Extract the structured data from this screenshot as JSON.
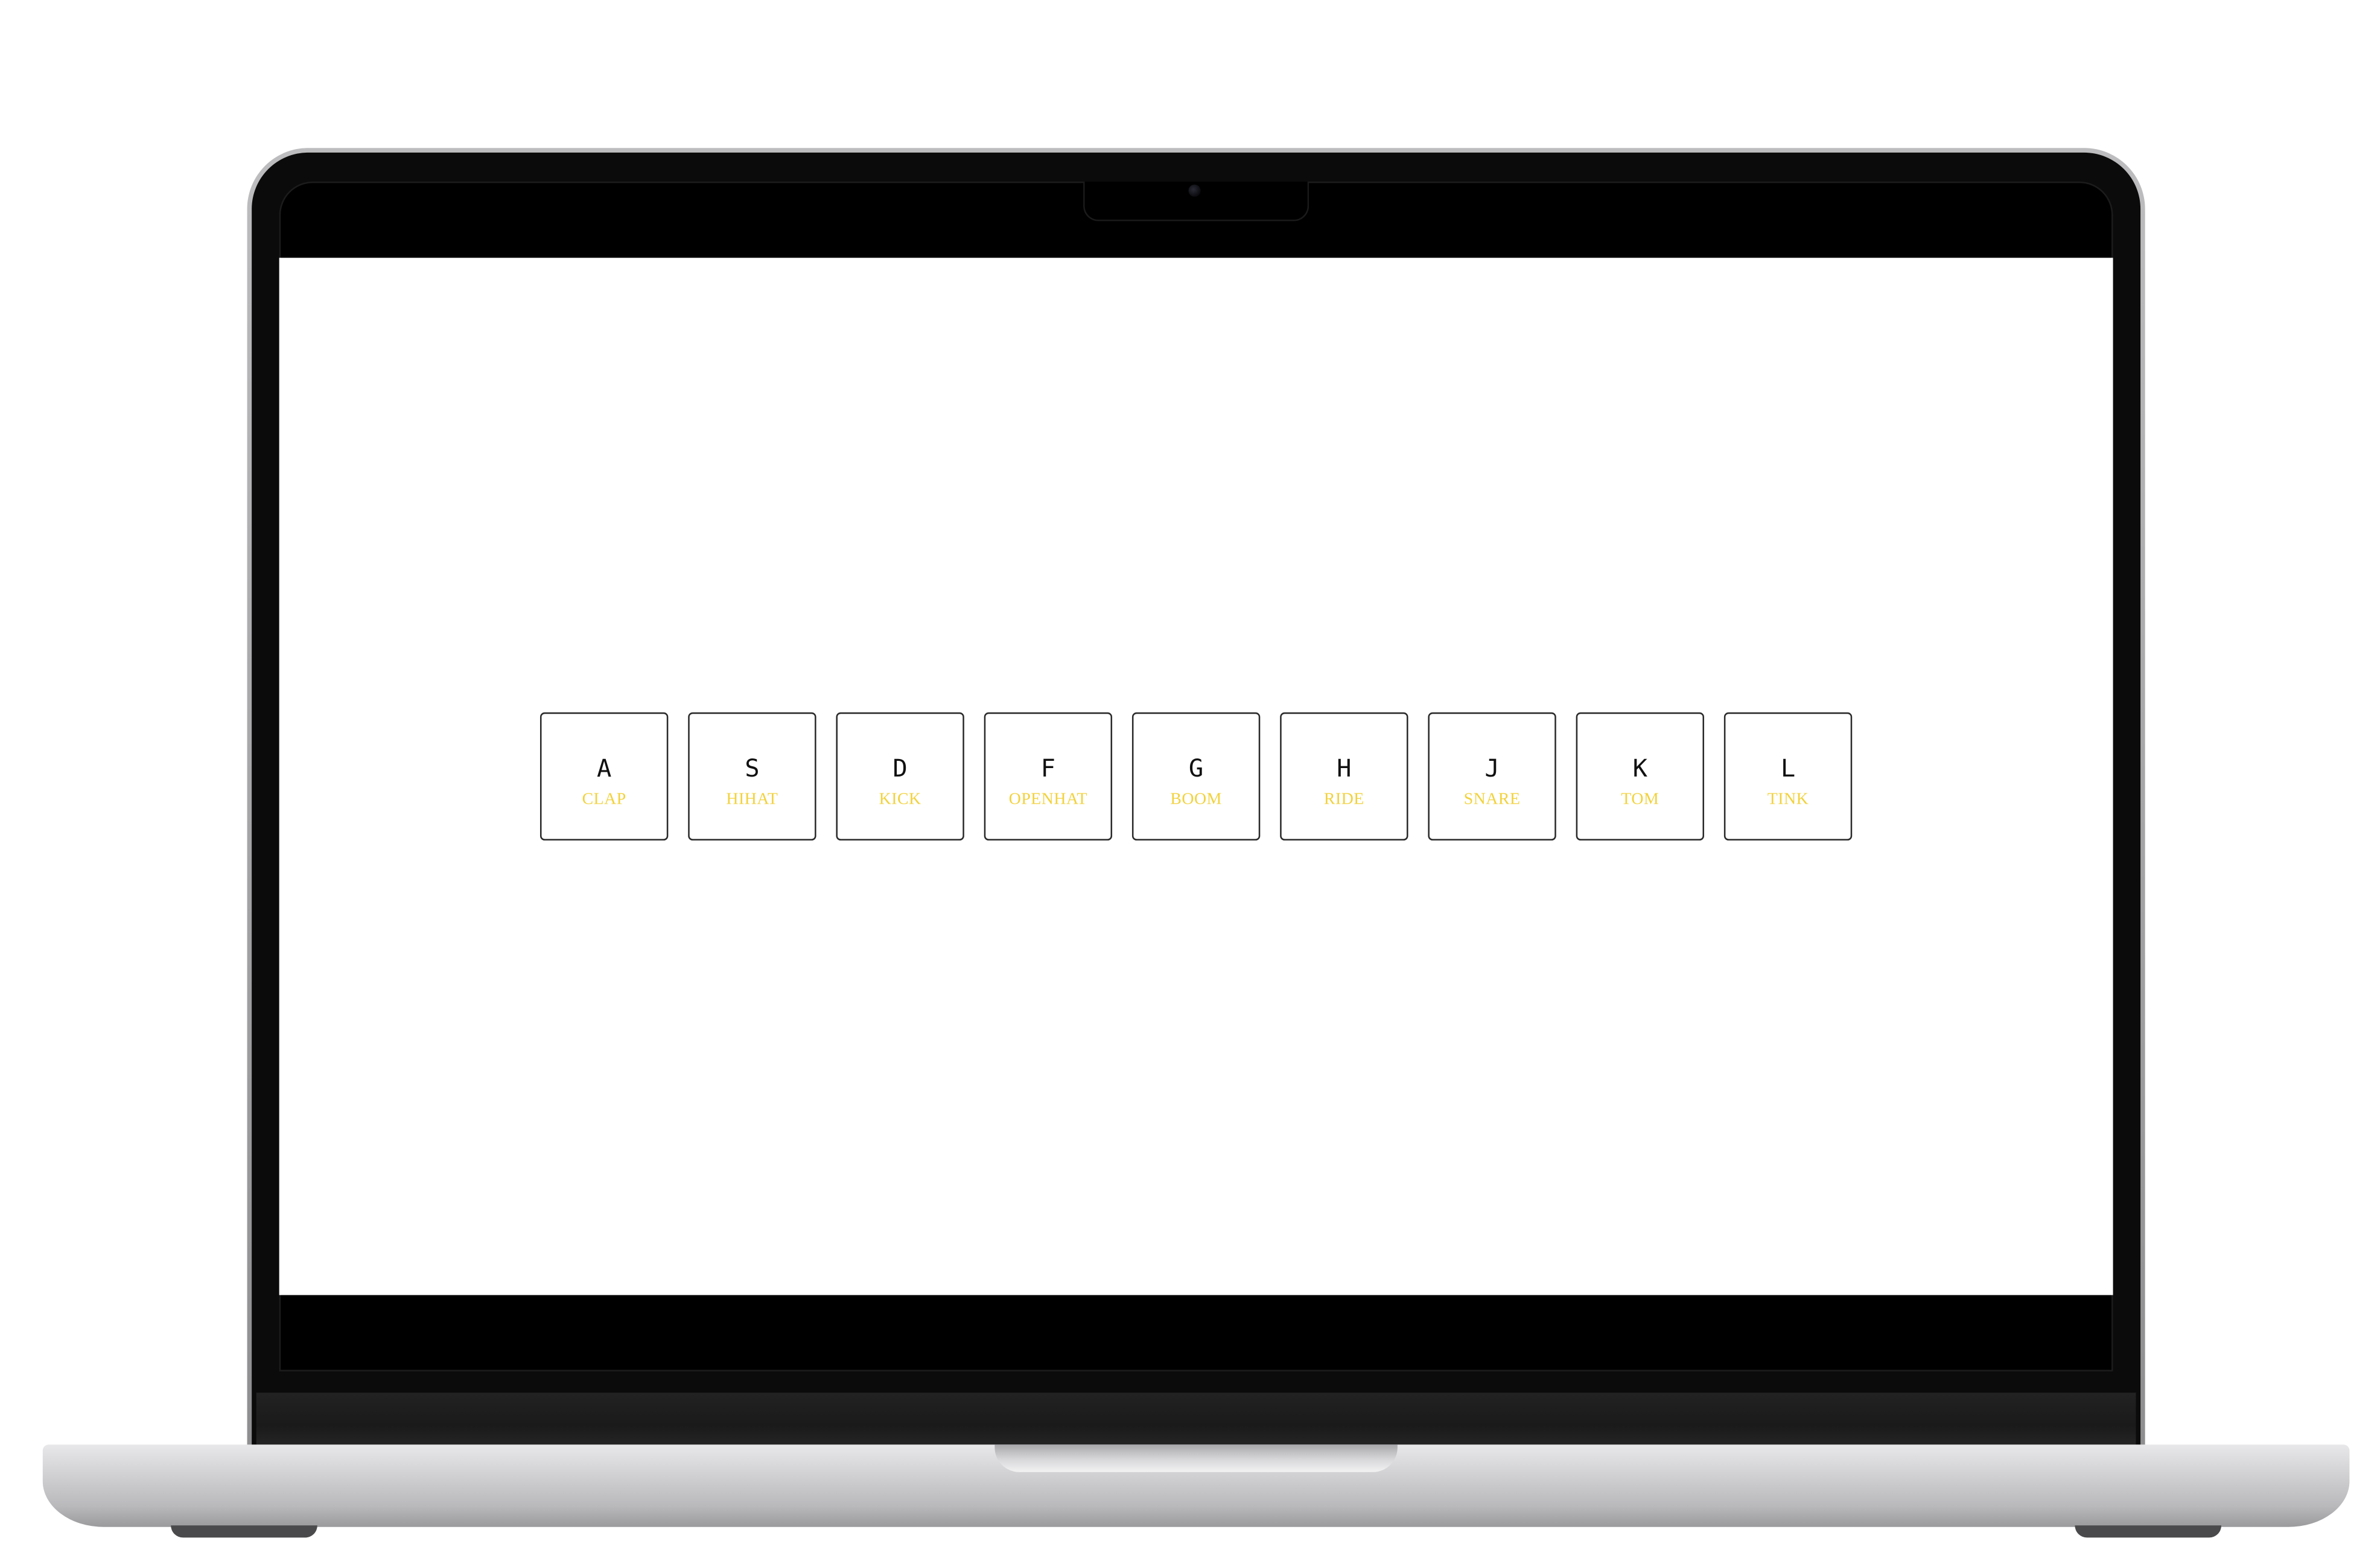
{
  "drum_kit": {
    "keys": [
      {
        "key": "A",
        "sound": "CLAP"
      },
      {
        "key": "S",
        "sound": "HIHAT"
      },
      {
        "key": "D",
        "sound": "KICK"
      },
      {
        "key": "F",
        "sound": "OPENHAT"
      },
      {
        "key": "G",
        "sound": "BOOM"
      },
      {
        "key": "H",
        "sound": "RIDE"
      },
      {
        "key": "J",
        "sound": "SNARE"
      },
      {
        "key": "K",
        "sound": "TOM"
      },
      {
        "key": "L",
        "sound": "TINK"
      }
    ]
  },
  "colors": {
    "sound_label": "#f2d23c",
    "key_border": "#2a2a2a",
    "key_letter": "#111111"
  }
}
